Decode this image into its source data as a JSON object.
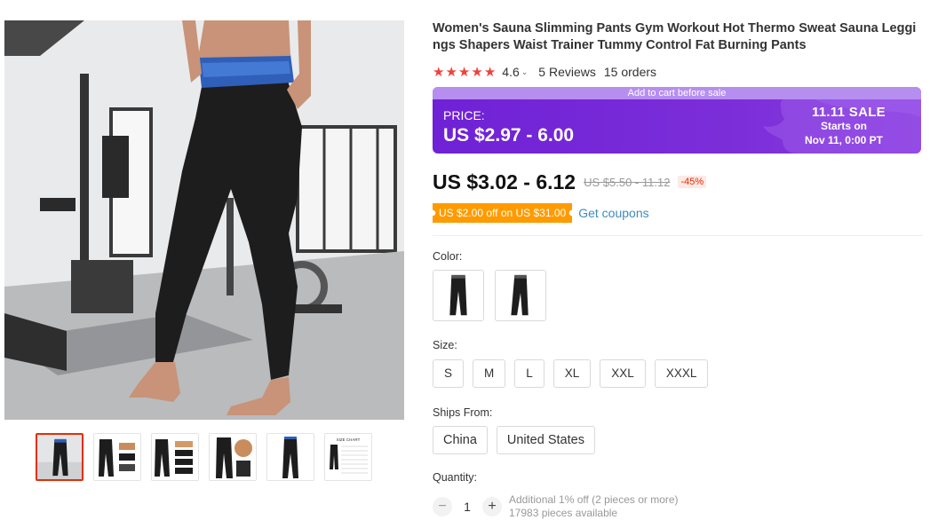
{
  "product": {
    "title": "Women's Sauna Slimming Pants Gym Workout Hot Thermo Sweat Sauna Leggings Shapers Waist Trainer Tummy Control Fat Burning Pants",
    "rating": {
      "stars": 5,
      "value": "4.6",
      "caret": "⌄",
      "reviews": "5 Reviews",
      "orders": "15 orders",
      "star_color": "#f0423d"
    },
    "sale_banner": {
      "top_text": "Add to cart before sale",
      "price_label": "PRICE:",
      "price": "US $2.97 - 6.00",
      "sale_name": "11.11 SALE",
      "starts": "Starts on",
      "date": "Nov 11, 0:00 PT",
      "accent": "#7b2ed8"
    },
    "price": {
      "current": "US $3.02 - 6.12",
      "original": "US $5.50 - 11.12",
      "discount": "-45%"
    },
    "coupon": {
      "tag": "US $2.00 off on US $31.00",
      "link": "Get coupons",
      "tag_color": "#ff9b00"
    },
    "color": {
      "label": "Color:",
      "options": [
        "black-pants-front",
        "black-pants-side"
      ]
    },
    "size": {
      "label": "Size:",
      "options": [
        "S",
        "M",
        "L",
        "XL",
        "XXL",
        "XXXL"
      ]
    },
    "ships_from": {
      "label": "Ships From:",
      "options": [
        "China",
        "United States"
      ]
    },
    "quantity": {
      "label": "Quantity:",
      "minus": "−",
      "plus": "+",
      "value": "1",
      "note1": "Additional 1% off (2 pieces or more)",
      "note2": "17983 pieces available"
    }
  },
  "gallery": {
    "thumbnails": [
      "main-photo",
      "pants-with-belt",
      "pants-with-belt-2",
      "pants-closeup",
      "pants-full-length",
      "size-chart"
    ],
    "size_chart_label": "SIZE CHART"
  }
}
